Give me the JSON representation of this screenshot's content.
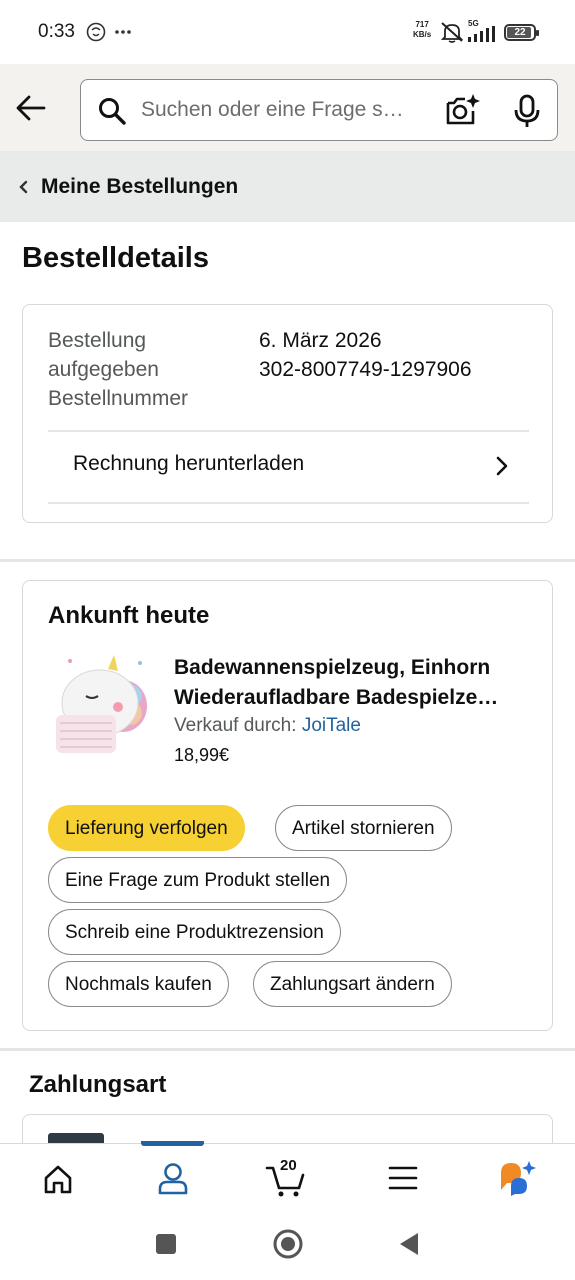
{
  "status_bar": {
    "time": "0:33",
    "net_speed_value": "717",
    "net_speed_unit": "KB/s",
    "network": "5G",
    "battery": "22"
  },
  "search": {
    "placeholder": "Suchen oder eine Frage s…"
  },
  "breadcrumb": {
    "label": "Meine Bestellungen"
  },
  "page_title": "Bestelldetails",
  "order_info": {
    "placed_label_line1": "Bestellung",
    "placed_label_line2": "aufgegeben",
    "placed_value": "6. März 2026",
    "number_label": "Bestellnummer",
    "number_value": "302-8007749-1297906",
    "invoice_label": "Rechnung herunterladen"
  },
  "shipment": {
    "heading": "Ankunft heute",
    "product_title_line1": "Badewannenspielzeug, Einhorn",
    "product_title_line2": "Wiederaufladbare Badespielze…",
    "seller_prefix": "Verkauf durch:",
    "seller_name": "JoiTale",
    "price": "18,99€",
    "actions": {
      "track": "Lieferung verfolgen",
      "cancel": "Artikel stornieren",
      "question": "Eine Frage zum Produkt stellen",
      "review": "Schreib eine Produktrezension",
      "buy_again": "Nochmals kaufen",
      "change_payment": "Zahlungsart ändern"
    }
  },
  "payment": {
    "heading": "Zahlungsart"
  },
  "bottom_nav": {
    "cart_count": "20",
    "active": "account",
    "accent_color": "#2162a1"
  },
  "colors": {
    "primary_button": "#f7d034",
    "link": "#2162a1",
    "header_bg": "#f3f2ef"
  }
}
